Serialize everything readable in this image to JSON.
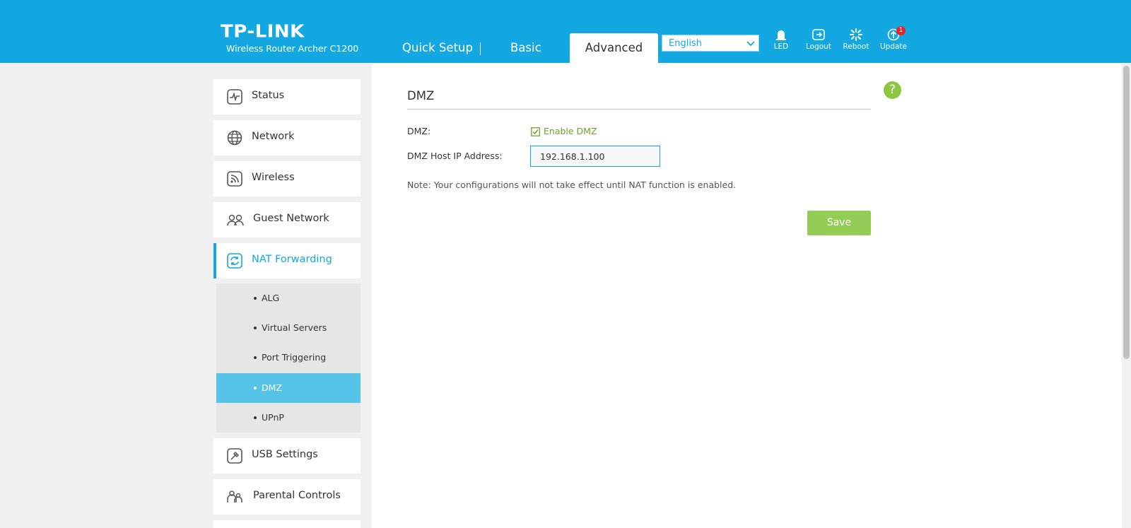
{
  "header": {
    "logo": "TP-LINK",
    "model": "Wireless Router Archer C1200",
    "tabs": [
      {
        "label": "Quick Setup"
      },
      {
        "label": "Basic"
      },
      {
        "label": "Advanced",
        "active": true
      }
    ],
    "language": "English",
    "icons": [
      {
        "label": "LED",
        "icon": "led-icon"
      },
      {
        "label": "Logout",
        "icon": "logout-icon"
      },
      {
        "label": "Reboot",
        "icon": "reboot-icon"
      },
      {
        "label": "Update",
        "icon": "update-icon",
        "badge": "1"
      }
    ],
    "brand_color": "#13a8e1"
  },
  "sidebar": {
    "items": [
      {
        "label": "Status",
        "icon": "status-icon"
      },
      {
        "label": "Network",
        "icon": "globe-icon"
      },
      {
        "label": "Wireless",
        "icon": "wireless-icon"
      },
      {
        "label": "Guest Network",
        "icon": "guest-network-icon"
      },
      {
        "label": "NAT Forwarding",
        "icon": "nat-forwarding-icon",
        "active": true
      },
      {
        "label": "USB Settings",
        "icon": "usb-settings-icon"
      },
      {
        "label": "Parental Controls",
        "icon": "parental-controls-icon"
      }
    ],
    "submenu": [
      {
        "label": "ALG"
      },
      {
        "label": "Virtual Servers"
      },
      {
        "label": "Port Triggering"
      },
      {
        "label": "DMZ",
        "selected": true
      },
      {
        "label": "UPnP"
      }
    ]
  },
  "main": {
    "title": "DMZ",
    "dmz_label": "DMZ:",
    "enable_label": "Enable DMZ",
    "enable_checked": true,
    "ip_label": "DMZ Host IP Address:",
    "ip_value": "192.168.1.100",
    "note": "Note: Your configurations will not take effect until NAT function is enabled.",
    "save_label": "Save",
    "help": "?",
    "accent_color": "#94cc55"
  }
}
